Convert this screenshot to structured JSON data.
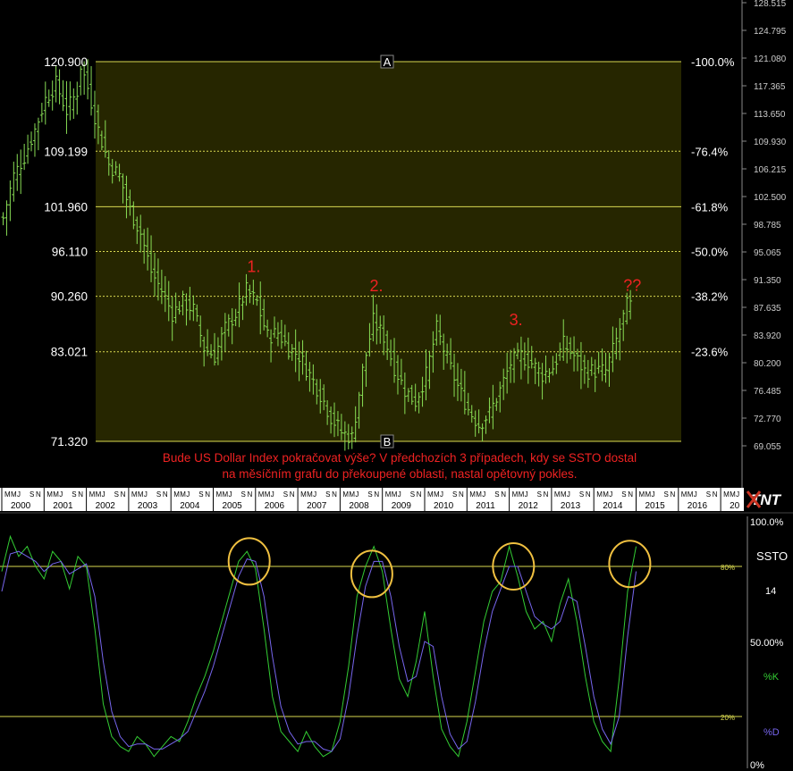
{
  "colors": {
    "background": "#000000",
    "fib_zone": "#262600",
    "fib_line": "#d8d850",
    "price_bars": "#88dd55",
    "annotation": "#ee2222",
    "circle": "#f0c040",
    "stoch_k": "#33cc33",
    "stoch_d": "#7766ee",
    "axis_text": "#ffffff",
    "right_axis_text": "#cccccc",
    "timeline_bg": "#ffffff"
  },
  "chart_data": [
    {
      "type": "ohlc",
      "description_role": "price",
      "ylim": [
        66.0,
        129.5
      ],
      "left_labels": [
        "120.900",
        "109.199",
        "101.960",
        "96.110",
        "90.260",
        "83.021",
        "71.320"
      ],
      "fib_levels": [
        {
          "value": 120.9,
          "label": "-100.0%",
          "solid": true
        },
        {
          "value": 109.199,
          "label": "-76.4%",
          "solid": false
        },
        {
          "value": 101.96,
          "label": "-61.8%",
          "solid": true
        },
        {
          "value": 96.11,
          "label": "-50.0%",
          "solid": false
        },
        {
          "value": 90.26,
          "label": "-38.2%",
          "solid": false
        },
        {
          "value": 83.021,
          "label": "-23.6%",
          "solid": false
        },
        {
          "value": 71.32,
          "label": "",
          "solid": true
        }
      ],
      "right_ticks": [
        "128.515",
        "124.795",
        "121.080",
        "117.365",
        "113.650",
        "109.930",
        "106.215",
        "102.500",
        "98.785",
        "95.065",
        "91.350",
        "87.635",
        "83.920",
        "80.200",
        "76.485",
        "72.770",
        "69.055"
      ],
      "points": [
        {
          "label": "A",
          "date": 2001.83,
          "value": 120.9
        },
        {
          "label": "B",
          "date": 2008.25,
          "value": 71.32
        }
      ],
      "annotations": [
        {
          "text": "1.",
          "date": 2005.8,
          "value": 93.4
        },
        {
          "text": "2.",
          "date": 2008.7,
          "value": 90.9
        },
        {
          "text": "3.",
          "date": 2012.0,
          "value": 86.5
        },
        {
          "text": "??",
          "date": 2014.7,
          "value": 91.0
        }
      ],
      "caption": [
        "Bude US Dollar Index pokračovat výše? V předchozích 3 případech, kdy se SSTO dostal",
        "na měsíčním grafu do překoupené oblasti, nastal opětovný pokles."
      ],
      "series": [
        {
          "name": "",
          "x": [
            2000.0,
            2000.25,
            2000.5,
            2000.75,
            2001.0,
            2001.25,
            2001.5,
            2001.75,
            2001.83,
            2002.0,
            2002.25,
            2002.5,
            2002.75,
            2003.0,
            2003.25,
            2003.5,
            2003.75,
            2004.0,
            2004.25,
            2004.5,
            2004.75,
            2005.0,
            2005.25,
            2005.5,
            2005.75,
            2006.0,
            2006.25,
            2006.5,
            2006.75,
            2007.0,
            2007.25,
            2007.5,
            2007.75,
            2008.0,
            2008.25,
            2008.5,
            2008.75,
            2009.0,
            2009.25,
            2009.5,
            2009.75,
            2010.0,
            2010.25,
            2010.5,
            2010.75,
            2011.0,
            2011.25,
            2011.5,
            2011.75,
            2012.0,
            2012.25,
            2012.5,
            2012.75,
            2013.0,
            2013.25,
            2013.5,
            2013.75,
            2014.0,
            2014.25,
            2014.5,
            2014.75
          ],
          "close": [
            100.5,
            106.0,
            108.5,
            112.0,
            116.0,
            118.0,
            114.5,
            117.0,
            120.5,
            117.5,
            112.0,
            107.5,
            106.0,
            101.5,
            98.5,
            93.5,
            91.0,
            88.0,
            89.5,
            88.5,
            83.5,
            82.5,
            86.0,
            88.0,
            91.0,
            89.5,
            85.0,
            85.5,
            83.5,
            82.5,
            80.0,
            77.5,
            74.5,
            72.5,
            71.8,
            80.5,
            87.0,
            85.0,
            81.0,
            78.0,
            76.5,
            80.0,
            86.0,
            82.0,
            78.5,
            75.5,
            73.5,
            75.0,
            78.0,
            81.5,
            82.5,
            81.5,
            80.0,
            81.0,
            84.0,
            82.5,
            80.5,
            80.5,
            80.5,
            84.5,
            89.0
          ]
        }
      ],
      "x_ticks": [
        "2000",
        "2001",
        "2002",
        "2003",
        "2004",
        "2005",
        "2006",
        "2007",
        "2008",
        "2009",
        "2010",
        "2011",
        "2012",
        "2013",
        "2014",
        "2015",
        "2016",
        "20"
      ],
      "month_marks": "MMJ SN"
    },
    {
      "type": "line",
      "description_role": "stochastic",
      "ylim": [
        0,
        100
      ],
      "title": "SSTO",
      "period": "14",
      "right_labels": [
        "100.0%",
        "50.00%",
        "0%"
      ],
      "level_labels": [
        "80%",
        "20%"
      ],
      "levels": [
        80,
        20
      ],
      "legend": [
        "%K",
        "%D"
      ],
      "circles": [
        {
          "date": 2005.85,
          "value": 82
        },
        {
          "date": 2008.75,
          "value": 77
        },
        {
          "date": 2012.1,
          "value": 80
        },
        {
          "date": 2014.85,
          "value": 81
        }
      ],
      "series": [
        {
          "name": "%K",
          "x": [
            2000.0,
            2000.2,
            2000.4,
            2000.6,
            2000.8,
            2001.0,
            2001.2,
            2001.4,
            2001.6,
            2001.8,
            2002.0,
            2002.2,
            2002.4,
            2002.6,
            2002.8,
            2003.0,
            2003.2,
            2003.4,
            2003.6,
            2003.8,
            2004.0,
            2004.2,
            2004.4,
            2004.6,
            2004.8,
            2005.0,
            2005.2,
            2005.4,
            2005.6,
            2005.8,
            2006.0,
            2006.2,
            2006.4,
            2006.6,
            2006.8,
            2007.0,
            2007.2,
            2007.4,
            2007.6,
            2007.8,
            2008.0,
            2008.2,
            2008.4,
            2008.6,
            2008.8,
            2009.0,
            2009.2,
            2009.4,
            2009.6,
            2009.8,
            2010.0,
            2010.2,
            2010.4,
            2010.6,
            2010.8,
            2011.0,
            2011.2,
            2011.4,
            2011.6,
            2011.8,
            2012.0,
            2012.2,
            2012.4,
            2012.6,
            2012.8,
            2013.0,
            2013.2,
            2013.4,
            2013.6,
            2013.8,
            2014.0,
            2014.2,
            2014.4,
            2014.6,
            2014.8,
            2015.0
          ],
          "values": [
            78,
            92,
            84,
            88,
            80,
            75,
            86,
            82,
            71,
            84,
            80,
            55,
            25,
            12,
            8,
            6,
            12,
            9,
            4,
            8,
            12,
            10,
            18,
            28,
            36,
            46,
            58,
            70,
            82,
            86,
            79,
            55,
            28,
            14,
            10,
            6,
            14,
            8,
            4,
            6,
            18,
            40,
            68,
            80,
            88,
            78,
            55,
            35,
            28,
            42,
            62,
            36,
            15,
            8,
            4,
            18,
            38,
            58,
            70,
            74,
            88,
            76,
            62,
            55,
            58,
            50,
            65,
            75,
            58,
            36,
            18,
            10,
            6,
            35,
            70,
            88
          ]
        },
        {
          "name": "%D",
          "x": [
            2000.0,
            2000.2,
            2000.4,
            2000.6,
            2000.8,
            2001.0,
            2001.2,
            2001.4,
            2001.6,
            2001.8,
            2002.0,
            2002.2,
            2002.4,
            2002.6,
            2002.8,
            2003.0,
            2003.2,
            2003.4,
            2003.6,
            2003.8,
            2004.0,
            2004.2,
            2004.4,
            2004.6,
            2004.8,
            2005.0,
            2005.2,
            2005.4,
            2005.6,
            2005.8,
            2006.0,
            2006.2,
            2006.4,
            2006.6,
            2006.8,
            2007.0,
            2007.2,
            2007.4,
            2007.6,
            2007.8,
            2008.0,
            2008.2,
            2008.4,
            2008.6,
            2008.8,
            2009.0,
            2009.2,
            2009.4,
            2009.6,
            2009.8,
            2010.0,
            2010.2,
            2010.4,
            2010.6,
            2010.8,
            2011.0,
            2011.2,
            2011.4,
            2011.6,
            2011.8,
            2012.0,
            2012.2,
            2012.4,
            2012.6,
            2012.8,
            2013.0,
            2013.2,
            2013.4,
            2013.6,
            2013.8,
            2014.0,
            2014.2,
            2014.4,
            2014.6,
            2014.8,
            2015.0
          ],
          "values": [
            70,
            85,
            86,
            84,
            82,
            78,
            81,
            82,
            77,
            79,
            81,
            68,
            42,
            22,
            12,
            8,
            9,
            9,
            7,
            7,
            9,
            11,
            14,
            22,
            30,
            40,
            52,
            64,
            76,
            83,
            82,
            68,
            44,
            24,
            14,
            9,
            10,
            10,
            7,
            6,
            11,
            28,
            52,
            72,
            82,
            82,
            68,
            48,
            34,
            36,
            50,
            48,
            28,
            13,
            7,
            10,
            26,
            46,
            62,
            71,
            80,
            80,
            70,
            60,
            57,
            55,
            58,
            68,
            66,
            48,
            28,
            15,
            9,
            20,
            52,
            78
          ]
        }
      ]
    }
  ]
}
